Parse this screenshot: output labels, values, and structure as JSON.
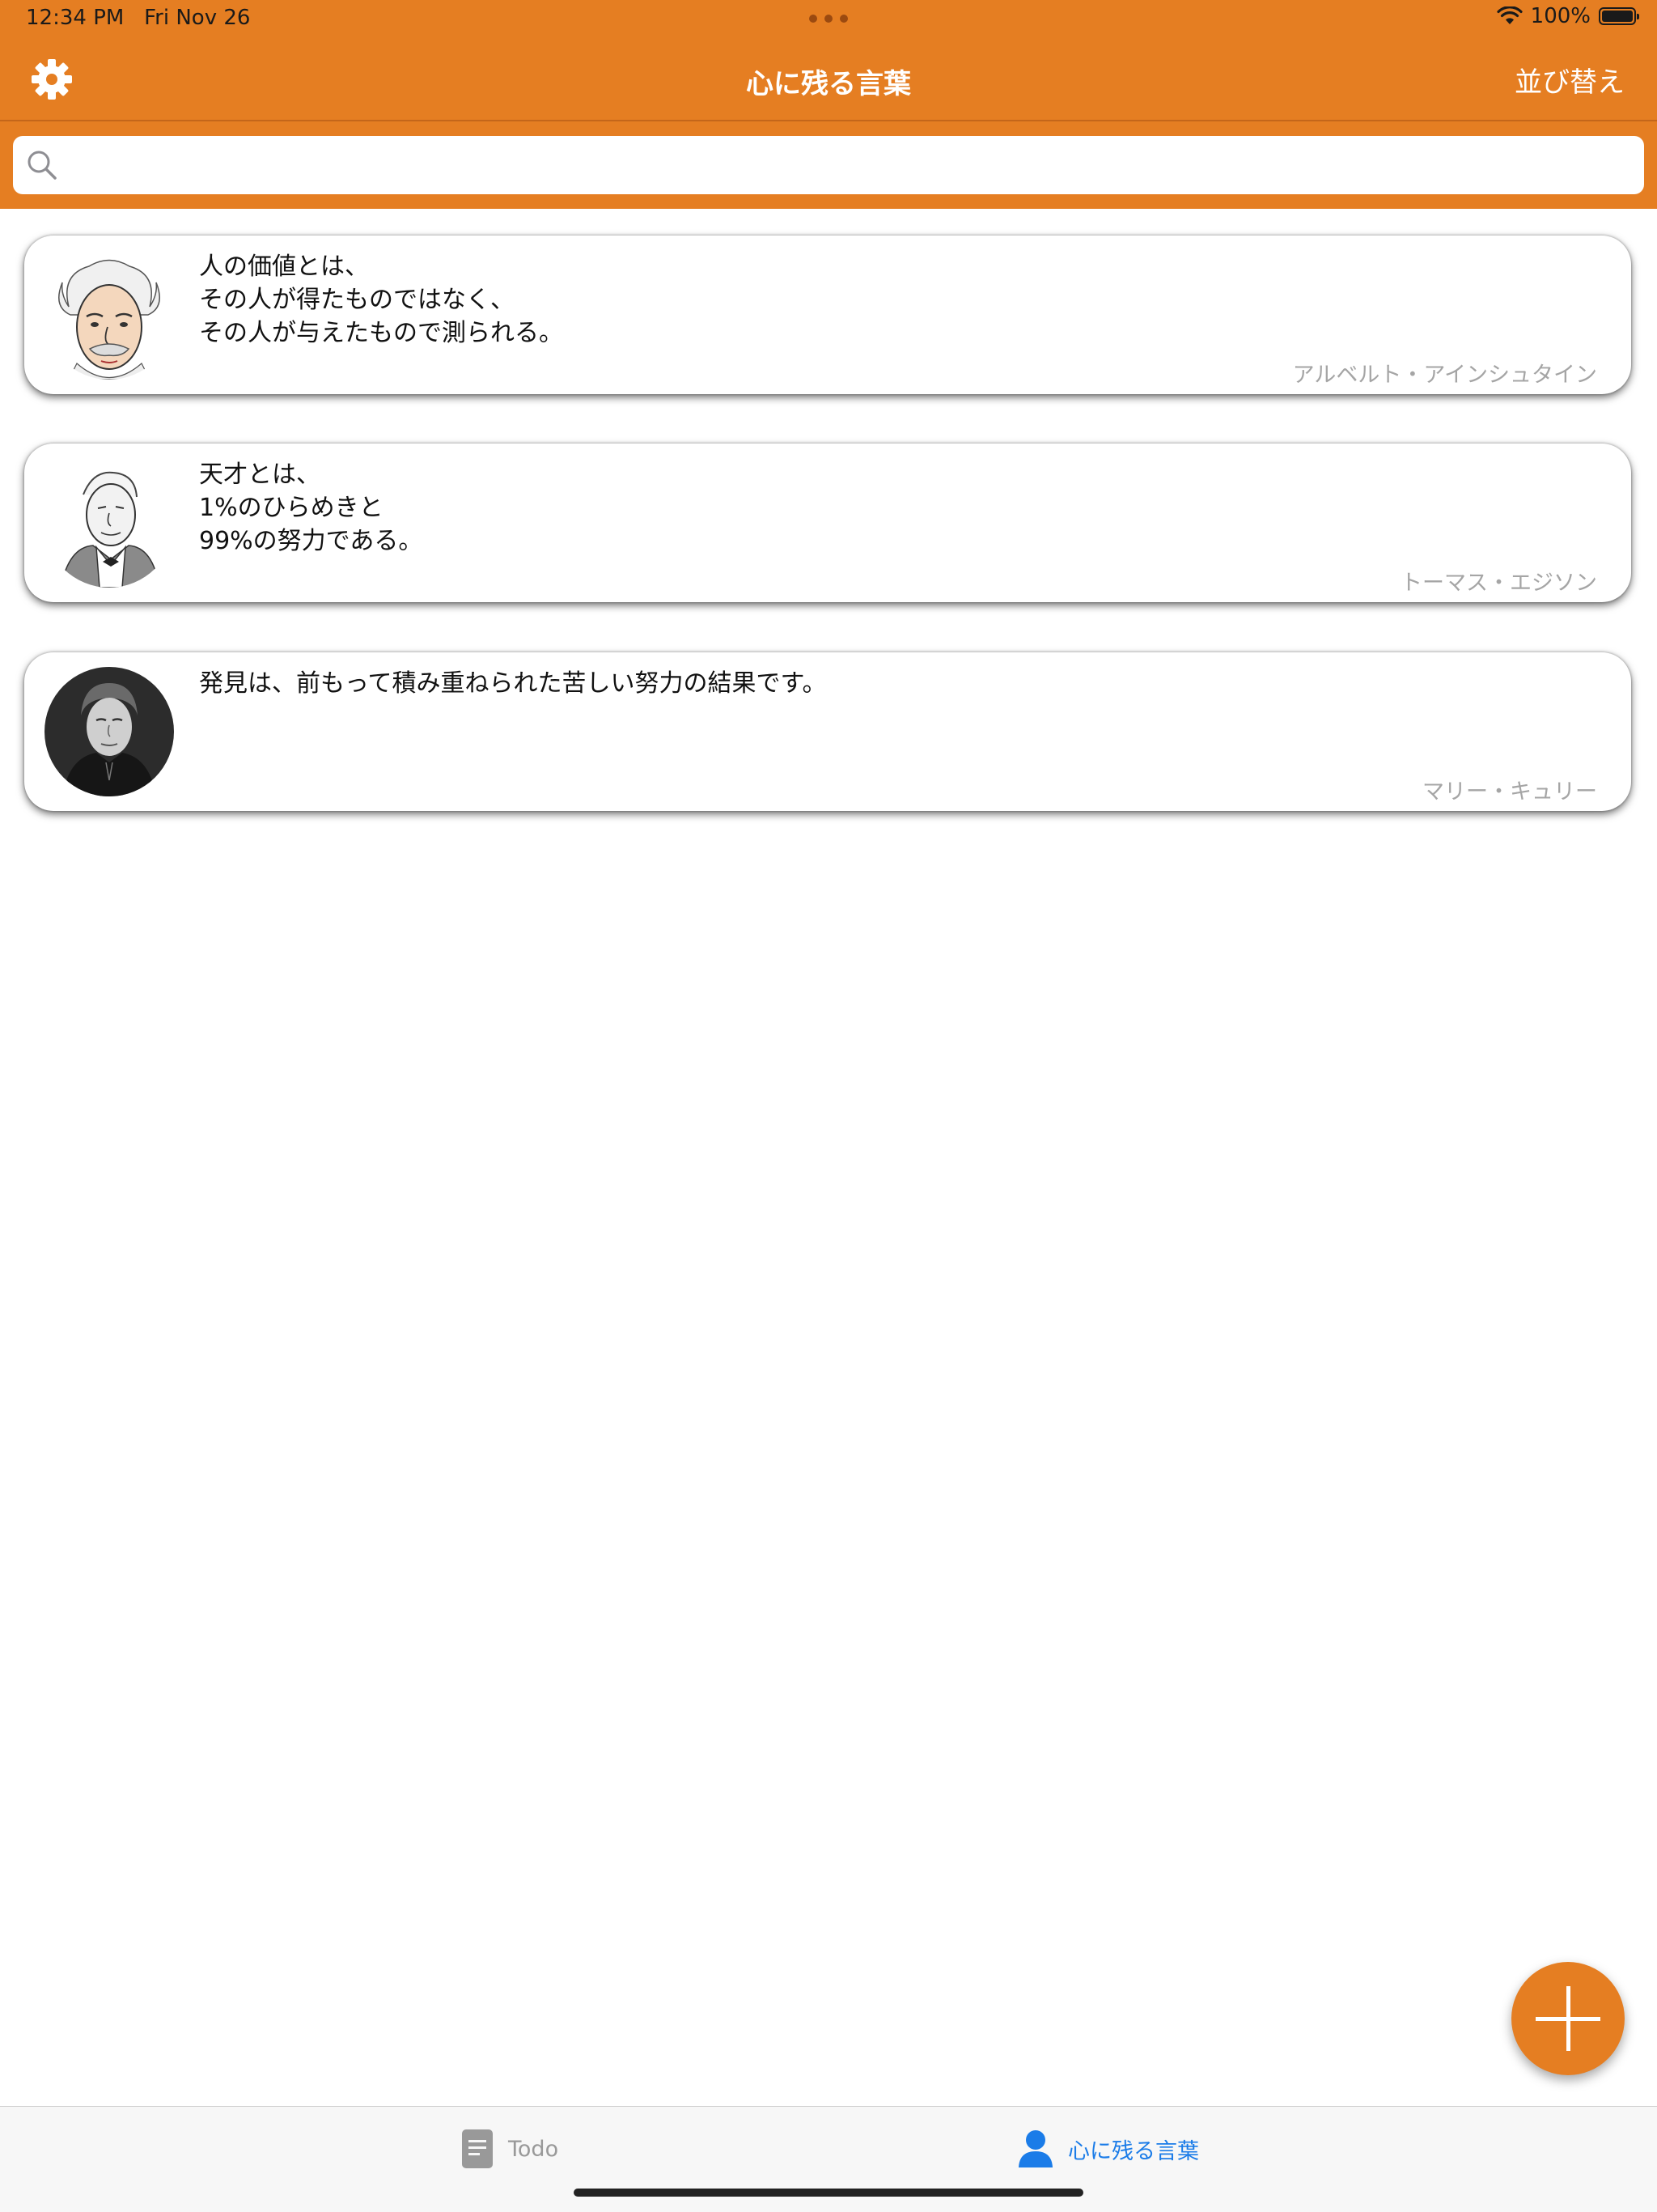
{
  "status_bar": {
    "time": "12:34 PM",
    "date": "Fri Nov 26",
    "battery": "100%"
  },
  "nav": {
    "title": "心に残る言葉",
    "sort_label": "並び替え"
  },
  "search": {
    "placeholder": "",
    "value": ""
  },
  "quotes": [
    {
      "text": "人の価値とは、\nその人が得たものではなく、\nその人が与えたもので測られる。",
      "author": "アルベルト・アインシュタイン"
    },
    {
      "text": "天才とは、\n1%のひらめきと\n99%の努力である。",
      "author": "トーマス・エジソン"
    },
    {
      "text": "発見は、前もって積み重ねられた苦しい努力の結果です。",
      "author": "マリー・キュリー"
    }
  ],
  "tabs": [
    {
      "label": "Todo",
      "selected": false
    },
    {
      "label": "心に残る言葉",
      "selected": true
    }
  ],
  "colors": {
    "accent": "#E57E22",
    "tab_selected": "#1B7CE8",
    "tab_unselected": "#999999",
    "author_text": "#A5A5A5"
  },
  "icons": {
    "settings": "gear-icon",
    "search": "search-icon",
    "add": "plus-icon",
    "todo_tab": "document-icon",
    "quotes_tab": "person-icon"
  }
}
